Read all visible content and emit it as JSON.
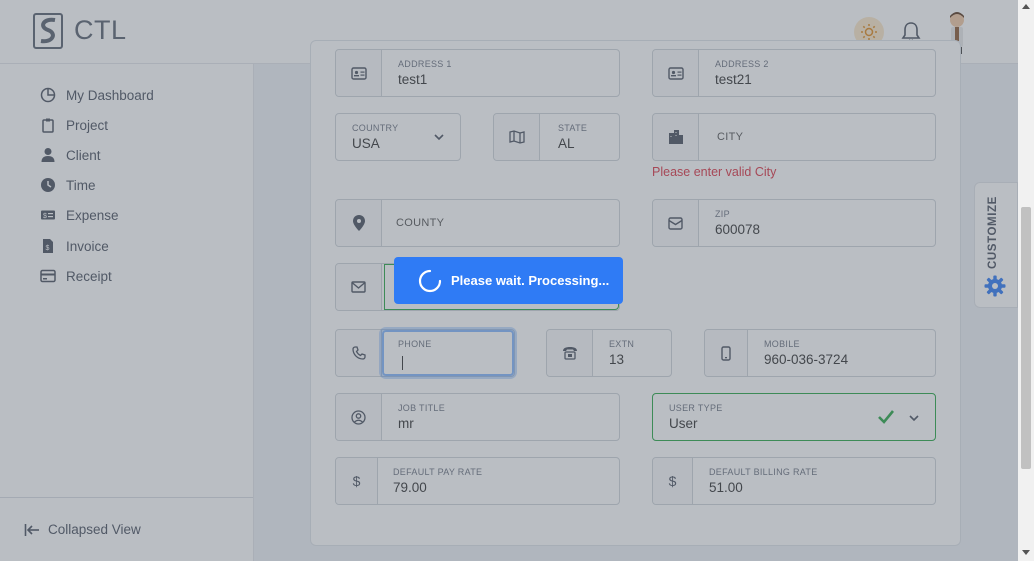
{
  "header": {
    "brand": "CTL",
    "icons": [
      "logo-icon",
      "sun-icon",
      "bell-icon",
      "avatar"
    ]
  },
  "sidebar": {
    "items": [
      {
        "label": "My Dashboard",
        "icon": "dashboard-icon"
      },
      {
        "label": "Project",
        "icon": "clipboard-icon"
      },
      {
        "label": "Client",
        "icon": "user-icon"
      },
      {
        "label": "Time",
        "icon": "clock-icon"
      },
      {
        "label": "Expense",
        "icon": "money-icon"
      },
      {
        "label": "Invoice",
        "icon": "invoice-icon"
      },
      {
        "label": "Receipt",
        "icon": "receipt-icon"
      }
    ],
    "collapse_label": "Collapsed View"
  },
  "form": {
    "address1": {
      "label": "ADDRESS 1",
      "value": "test1"
    },
    "address2": {
      "label": "ADDRESS 2",
      "value": "test21"
    },
    "country": {
      "label": "COUNTRY",
      "value": "USA"
    },
    "state": {
      "label": "STATE",
      "value": "AL"
    },
    "city": {
      "placeholder": "CITY",
      "error": "Please enter valid City"
    },
    "county": {
      "placeholder": "COUNTY"
    },
    "zip": {
      "label": "ZIP",
      "value": "600078"
    },
    "phone": {
      "label": "PHONE",
      "value": ""
    },
    "extn": {
      "label": "EXTN",
      "value": "13"
    },
    "mobile": {
      "label": "MOBILE",
      "value": "960-036-3724"
    },
    "job_title": {
      "label": "JOB TITLE",
      "value": "mr"
    },
    "user_type": {
      "label": "USER TYPE",
      "value": "User"
    },
    "pay_rate": {
      "label": "DEFAULT PAY RATE",
      "value": "79.00",
      "prefix": "$"
    },
    "billing_rate": {
      "label": "DEFAULT BILLING RATE",
      "value": "51.00",
      "prefix": "$"
    }
  },
  "customize_label": "CUSTOMIZE",
  "loader_text": "Please wait. Processing...",
  "colors": {
    "accent": "#2f7bf5",
    "error": "#dc3545",
    "valid": "#28a745"
  }
}
